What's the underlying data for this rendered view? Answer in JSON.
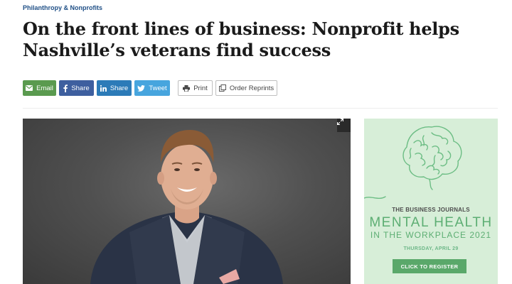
{
  "article": {
    "category": "Philanthropy & Nonprofits",
    "headline": "On the front lines of business: Nonprofit helps Nashville’s veterans find success"
  },
  "share": {
    "email": "Email",
    "facebook": "Share",
    "linkedin": "Share",
    "twitter": "Tweet",
    "print": "Print",
    "reprints": "Order Reprints"
  },
  "ad": {
    "brand": "THE BUSINESS JOURNALS",
    "title_line1": "MENTAL HEALTH",
    "title_line2": "IN THE WORKPLACE 2021",
    "date": "THURSDAY, APRIL 29",
    "cta": "CLICK TO REGISTER"
  },
  "colors": {
    "email": "#5a9a4f",
    "facebook": "#3e5f9f",
    "linkedin": "#2c7bb8",
    "twitter": "#47a5de",
    "ad_background": "#d7eed8",
    "ad_accent": "#5dae73"
  },
  "icons": [
    "envelope-icon",
    "facebook-icon",
    "linkedin-icon",
    "twitter-icon",
    "printer-icon",
    "reprints-icon",
    "expand-icon",
    "brain-icon"
  ]
}
